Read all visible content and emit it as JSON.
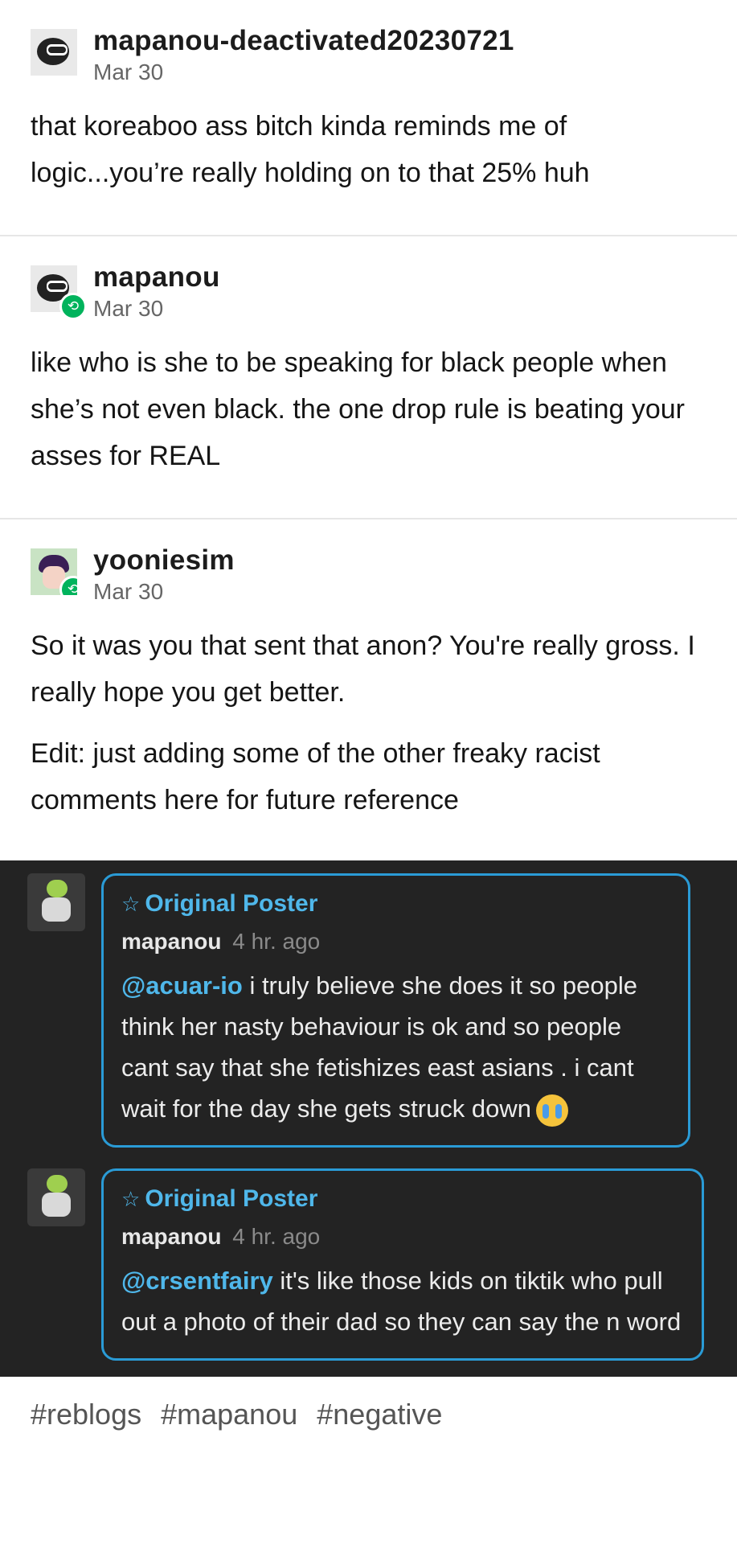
{
  "posts": [
    {
      "username": "mapanou-deactivated20230721",
      "date": "Mar 30",
      "avatar_icon": "tumblr-deactivated-icon",
      "paragraphs": [
        "that koreaboo ass bitch kinda reminds me of logic...you’re really holding on to that 25% huh"
      ]
    },
    {
      "username": "mapanou",
      "date": "Mar 30",
      "avatar_icon": "tumblr-deactivated-icon",
      "paragraphs": [
        "like who is she to be speaking for black people when she’s not even black. the one drop rule is beating your asses for REAL"
      ]
    },
    {
      "username": "yooniesim",
      "date": "Mar 30",
      "avatar_icon": "anime-avatar",
      "paragraphs": [
        "So it was you that sent that anon? You're really gross. I really hope you get better.",
        "Edit: just adding some of the other freaky racist comments here for future reference"
      ]
    }
  ],
  "reblog_badge_glyph": "⟲",
  "comments": [
    {
      "badge": "Original Poster",
      "badge_icon": "☆",
      "user": "mapanou",
      "time": "4 hr. ago",
      "mention": "@acuar-io",
      "text": " i truly believe she does it so people think her nasty behaviour is ok and so people cant say that she fetishizes east asians . i cant wait for the day she gets struck down",
      "emoji": "crying-face-emoji"
    },
    {
      "badge": "Original Poster",
      "badge_icon": "☆",
      "user": "mapanou",
      "time": "4 hr. ago",
      "mention": "@crsentfairy",
      "text": " it's like those kids on tiktik who pull out a photo of their dad so they can say the n word"
    }
  ],
  "tags": [
    "#reblogs",
    "#mapanou",
    "#negative"
  ],
  "colors": {
    "accent_blue": "#2a9bd6",
    "reblog_green": "#00b35c",
    "dark_bg": "#232323"
  }
}
